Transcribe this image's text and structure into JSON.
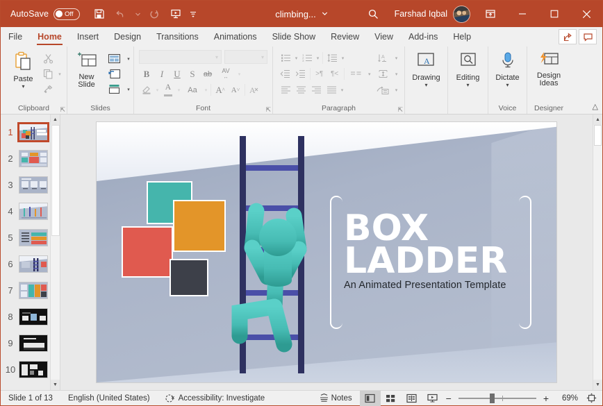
{
  "titlebar": {
    "autosave_label": "AutoSave",
    "autosave_state": "Off",
    "document_title": "climbing...",
    "user_name": "Farshad Iqbal",
    "quick_access": [
      {
        "name": "save-button",
        "label": "Save"
      },
      {
        "name": "undo-button",
        "label": "Undo"
      },
      {
        "name": "redo-button",
        "label": "Redo"
      },
      {
        "name": "start-from-beginning-button",
        "label": "Start From Beginning"
      },
      {
        "name": "customize-quick-access-toolbar-button",
        "label": "Customize Quick Access Toolbar"
      }
    ],
    "window_buttons": [
      "Ribbon Display Options",
      "Minimize",
      "Restore Down",
      "Close"
    ],
    "accent_color": "#b7472a"
  },
  "tabs": [
    {
      "label": "File",
      "active": false
    },
    {
      "label": "Home",
      "active": true
    },
    {
      "label": "Insert",
      "active": false
    },
    {
      "label": "Design",
      "active": false
    },
    {
      "label": "Transitions",
      "active": false
    },
    {
      "label": "Animations",
      "active": false
    },
    {
      "label": "Slide Show",
      "active": false
    },
    {
      "label": "Review",
      "active": false
    },
    {
      "label": "View",
      "active": false
    },
    {
      "label": "Add-ins",
      "active": false
    },
    {
      "label": "Help",
      "active": false
    }
  ],
  "tab_right_buttons": [
    {
      "name": "share-button",
      "label": "Share"
    },
    {
      "name": "comments-button",
      "label": "Comments"
    }
  ],
  "ribbon": {
    "collapse_label": "Collapse the Ribbon",
    "groups": [
      {
        "name": "clipboard",
        "label": "Clipboard",
        "has_dialog_launcher": true,
        "buttons": [
          {
            "name": "paste-button",
            "label": "Paste"
          },
          {
            "name": "cut-button",
            "label": "Cut"
          },
          {
            "name": "copy-button",
            "label": "Copy"
          },
          {
            "name": "format-painter-button",
            "label": "Format Painter"
          }
        ]
      },
      {
        "name": "slides",
        "label": "Slides",
        "has_dialog_launcher": false,
        "buttons": [
          {
            "name": "new-slide-button",
            "label": "New Slide"
          },
          {
            "name": "layout-button",
            "label": "Layout"
          },
          {
            "name": "reset-button",
            "label": "Reset"
          },
          {
            "name": "section-button",
            "label": "Section"
          }
        ]
      },
      {
        "name": "font",
        "label": "Font",
        "has_dialog_launcher": true,
        "font_name_value": "",
        "font_name_placeholder": "",
        "font_size_value": "",
        "font_size_placeholder": "",
        "buttons": [
          {
            "name": "bold-button",
            "label": "B"
          },
          {
            "name": "italic-button",
            "label": "I"
          },
          {
            "name": "underline-button",
            "label": "U"
          },
          {
            "name": "text-shadow-button",
            "label": "S"
          },
          {
            "name": "strikethrough-button",
            "label": "ab"
          },
          {
            "name": "character-spacing-button",
            "label": "AV"
          },
          {
            "name": "text-highlight-color-button",
            "label": "Text Highlight Color"
          },
          {
            "name": "font-color-button",
            "label": "Font Color"
          },
          {
            "name": "change-case-button",
            "label": "Aa"
          },
          {
            "name": "increase-font-size-button",
            "label": "A"
          },
          {
            "name": "decrease-font-size-button",
            "label": "A"
          },
          {
            "name": "clear-formatting-button",
            "label": "Clear All Formatting"
          }
        ]
      },
      {
        "name": "paragraph",
        "label": "Paragraph",
        "has_dialog_launcher": true,
        "buttons": [
          {
            "name": "bullets-button",
            "label": "Bullets"
          },
          {
            "name": "numbering-button",
            "label": "Numbering"
          },
          {
            "name": "line-spacing-button",
            "label": "Line Spacing"
          },
          {
            "name": "text-direction-button",
            "label": "Text Direction"
          },
          {
            "name": "decrease-indent-button",
            "label": "Decrease List Level"
          },
          {
            "name": "increase-indent-button",
            "label": "Increase List Level"
          },
          {
            "name": "ltr-button",
            "label": "Left-to-Right"
          },
          {
            "name": "rtl-button",
            "label": "Right-to-Left"
          },
          {
            "name": "columns-button",
            "label": "Add or Remove Columns"
          },
          {
            "name": "align-text-button",
            "label": "Align Text"
          },
          {
            "name": "align-left-button",
            "label": "Align Left"
          },
          {
            "name": "align-center-button",
            "label": "Center"
          },
          {
            "name": "align-right-button",
            "label": "Align Right"
          },
          {
            "name": "justify-button",
            "label": "Justify"
          },
          {
            "name": "convert-to-smartart-button",
            "label": "Convert to SmartArt"
          }
        ]
      },
      {
        "name": "drawing",
        "label": "",
        "big_label": "Drawing"
      },
      {
        "name": "editing",
        "label": "",
        "big_label": "Editing"
      },
      {
        "name": "voice",
        "label": "Voice",
        "big_label": "Dictate"
      },
      {
        "name": "designer",
        "label": "Designer",
        "big_label": "Design Ideas"
      }
    ]
  },
  "thumbnails": {
    "selected_index": 1,
    "slides": [
      {
        "number": "1",
        "dark": false
      },
      {
        "number": "2",
        "dark": false
      },
      {
        "number": "3",
        "dark": false
      },
      {
        "number": "4",
        "dark": false
      },
      {
        "number": "5",
        "dark": false
      },
      {
        "number": "6",
        "dark": false
      },
      {
        "number": "7",
        "dark": false
      },
      {
        "number": "8",
        "dark": true
      },
      {
        "number": "9",
        "dark": true
      },
      {
        "number": "10",
        "dark": true
      }
    ]
  },
  "slide": {
    "title_line1": "BOX",
    "title_line2": "LADDER",
    "subtitle": "An Animated Presentation Template",
    "colors": {
      "teal_box": "#45b5ac",
      "orange_box": "#e39529",
      "red_box": "#e05a4f",
      "dark_box": "#3d4049",
      "ladder_rail": "#2e3160",
      "ladder_rung": "#4a4fa8",
      "climber": "#49c3bd",
      "background": "#aab4c8"
    }
  },
  "status": {
    "slide_counter": "Slide 1 of 13",
    "language": "English (United States)",
    "accessibility": "Accessibility: Investigate",
    "notes_label": "Notes",
    "views": [
      {
        "name": "normal-view-button",
        "label": "Normal",
        "active": true
      },
      {
        "name": "slide-sorter-view-button",
        "label": "Slide Sorter",
        "active": false
      },
      {
        "name": "reading-view-button",
        "label": "Reading View",
        "active": false
      },
      {
        "name": "slide-show-button",
        "label": "Slide Show",
        "active": false
      }
    ],
    "zoom_out_label": "−",
    "zoom_in_label": "+",
    "zoom_level": "69%",
    "fit_label": "Fit slide to current window"
  }
}
